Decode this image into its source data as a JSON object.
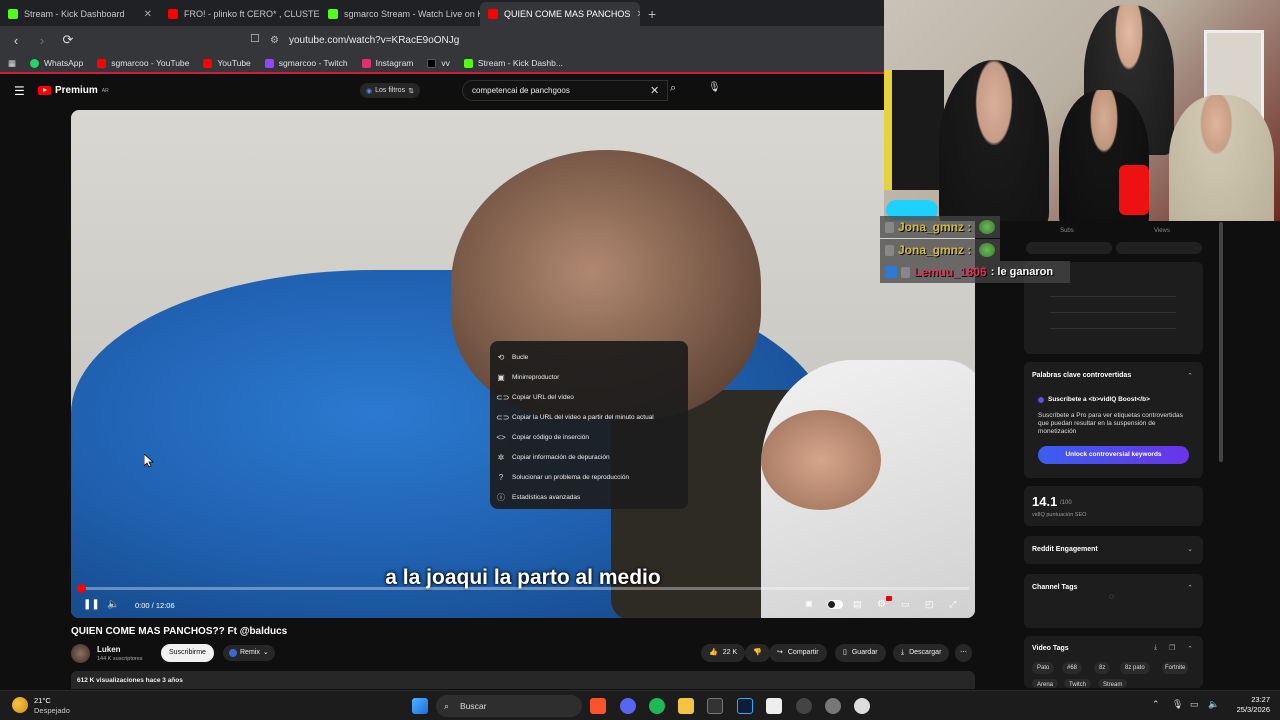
{
  "browser": {
    "tabs": [
      {
        "label": "Stream - Kick Dashboard",
        "color": "#53fc18",
        "active": false
      },
      {
        "label": "FRO! - plinko ft CERO* , CLUSTER",
        "color": "#ff0000",
        "active": false
      },
      {
        "label": "sgmarco Stream - Watch Live on Kick",
        "color": "#53fc18",
        "active": false
      },
      {
        "label": "QUIEN COME MAS PANCHOS",
        "color": "#ff0000",
        "active": true
      }
    ],
    "new_tab": "+",
    "url": "youtube.com/watch?v=KRacE9oONJg",
    "bookmarks": [
      {
        "label": "WhatsApp",
        "color": "#25d366"
      },
      {
        "label": "sgmarcoo - YouTube",
        "color": "#ff0000"
      },
      {
        "label": "YouTube",
        "color": "#ff0000"
      },
      {
        "label": "sgmarcoo - Twitch",
        "color": "#9146ff"
      },
      {
        "label": "Instagram",
        "color": "#e1306c"
      },
      {
        "label": "vv",
        "color": "#000000"
      },
      {
        "label": "Stream - Kick Dashb...",
        "color": "#53fc18"
      }
    ]
  },
  "youtube": {
    "logo_text": "Premium",
    "region": "AR",
    "filters_label": "Los filtros",
    "search_value": "competencai de panchgoos"
  },
  "video": {
    "subtitle": "a la joaqui la parto al medio",
    "time": "0:00 / 12:06",
    "progress_fraction": 0.005,
    "title": "QUIEN COME MAS PANCHOS?? Ft @balducs",
    "channel": "Luken",
    "subscribers": "144 K suscriptores",
    "subscribe_label": "Suscribirme",
    "remix_label": "Remix",
    "likes": "22 K",
    "share_label": "Compartir",
    "save_label": "Guardar",
    "download_label": "Descargar",
    "views_line": "612 K visualizaciones  hace 3 años"
  },
  "context_menu": [
    {
      "label": "Bucle",
      "icon": "loop-icon"
    },
    {
      "label": "Minirreproductor",
      "icon": "miniplayer-icon"
    },
    {
      "label": "Copiar URL del vídeo",
      "icon": "link-icon"
    },
    {
      "label": "Copiar la URL del vídeo a partir del minuto actual",
      "icon": "link-icon"
    },
    {
      "label": "Copiar código de inserción",
      "icon": "code-icon"
    },
    {
      "label": "Copiar información de depuración",
      "icon": "bug-icon"
    },
    {
      "label": "Solucionar un problema de reproducción",
      "icon": "help-icon"
    },
    {
      "label": "Estadísticas avanzadas",
      "icon": "info-icon"
    }
  ],
  "chat": [
    {
      "user": "Jona_gmnz :",
      "message": ""
    },
    {
      "user": "Jona_gmnz :",
      "message": ""
    },
    {
      "user": "Lemuu_1806",
      "message": ": le ganaron"
    }
  ],
  "sidebar": {
    "tabs": [
      "Subs",
      "Views"
    ],
    "controversial_title": "Palabras clave controvertidas",
    "boost_title": "Suscríbete a <b>vidIQ Boost</b>",
    "boost_text": "Suscríbete a Pro para ver etiquetas controvertidas que puedan resultar en la suspensión de monetización",
    "unlock_label": "Unlock controversial keywords",
    "score": "14.1",
    "score_of": "/100",
    "score_label": "vidIQ puntuación SEO",
    "reddit_title": "Reddit Engagement",
    "channel_tags_title": "Channel Tags",
    "video_tags_title": "Video Tags",
    "tags": [
      "Pato",
      "#68",
      "8z",
      "8z pato",
      "Fortnite",
      "Arena",
      "Twitch",
      "Stream"
    ]
  },
  "taskbar": {
    "temperature": "21°C",
    "weather": "Despejado",
    "search_label": "Buscar",
    "time": "23:27",
    "date": "25/3/2026"
  }
}
